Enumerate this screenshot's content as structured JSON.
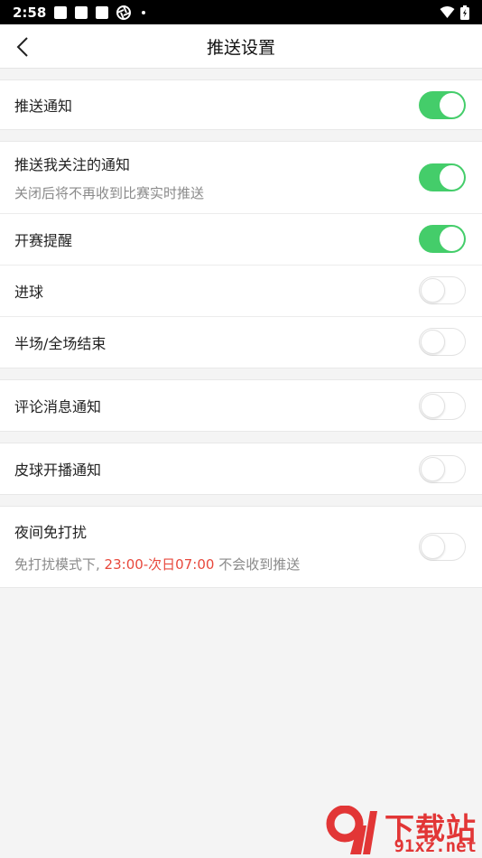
{
  "status_bar": {
    "time": "2:58"
  },
  "header": {
    "title": "推送设置"
  },
  "groups": [
    {
      "rows": [
        {
          "label": "推送通知",
          "on": true
        }
      ]
    },
    {
      "rows": [
        {
          "label": "推送我关注的通知",
          "sub": "关闭后将不再收到比赛实时推送",
          "on": true
        },
        {
          "label": "开赛提醒",
          "on": true
        },
        {
          "label": "进球",
          "on": false
        },
        {
          "label": "半场/全场结束",
          "on": false
        }
      ]
    },
    {
      "rows": [
        {
          "label": "评论消息通知",
          "on": false
        }
      ]
    },
    {
      "rows": [
        {
          "label": "皮球开播通知",
          "on": false
        }
      ]
    },
    {
      "rows": [
        {
          "label": "夜间免打扰",
          "sub_prefix": "免打扰模式下, ",
          "sub_highlight": "23:00-次日07:00",
          "sub_suffix": " 不会收到推送",
          "on": false
        }
      ]
    }
  ],
  "colors": {
    "toggle_on": "#44cd6a",
    "highlight": "#e8483c"
  },
  "watermark": {
    "title": "下载站",
    "domain": "91xz.net"
  }
}
